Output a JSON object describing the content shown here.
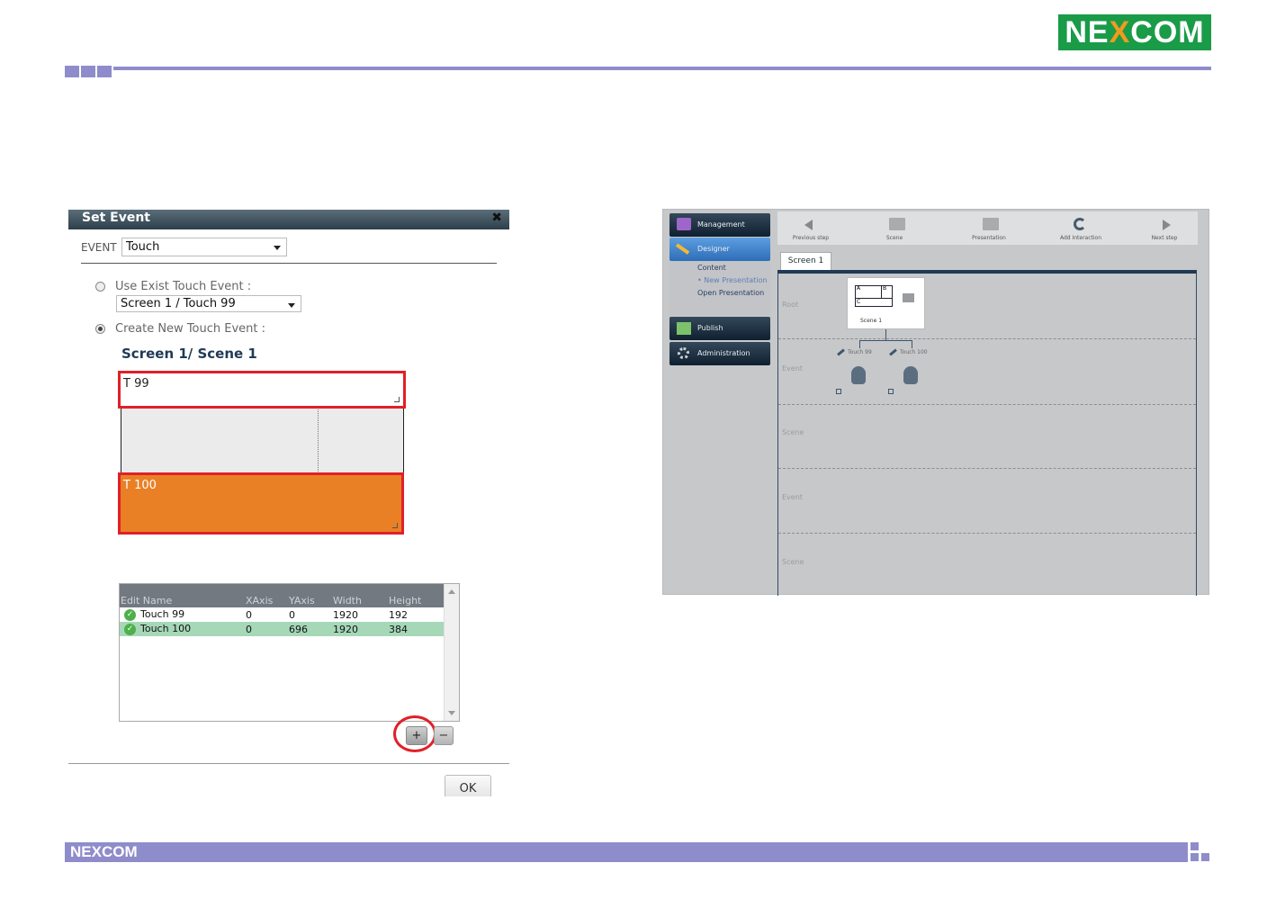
{
  "header": {
    "logo_pre": "NE",
    "logo_x": "X",
    "logo_post": "COM"
  },
  "footer": {
    "logo_pre": "NE",
    "logo_x": "X",
    "logo_post": "COM"
  },
  "dialog": {
    "title": "Set Event",
    "close_glyph": "✖",
    "event_label": "EVENT",
    "event_value": "Touch",
    "use_exist_label": "Use Exist Touch Event :",
    "use_exist_value": "Screen 1 / Touch 99",
    "create_new_label": "Create New Touch Event :",
    "scene_heading": "Screen 1/ Scene 1",
    "region_top_text": "T 99",
    "region_bottom_text": "T 100",
    "table": {
      "columns": [
        "Edit Name",
        "XAxis",
        "YAxis",
        "Width",
        "Height"
      ],
      "rows": [
        {
          "name": "Touch 99",
          "x": "0",
          "y": "0",
          "w": "1920",
          "h": "192"
        },
        {
          "name": "Touch 100",
          "x": "0",
          "y": "696",
          "w": "1920",
          "h": "384"
        }
      ]
    },
    "add_label": "+",
    "remove_label": "−",
    "ok_label": "OK"
  },
  "app": {
    "nav": [
      {
        "label": "Management"
      },
      {
        "label": "Designer"
      },
      {
        "label": "Publish"
      },
      {
        "label": "Administration"
      }
    ],
    "subnav": [
      "Content",
      "• New Presentation",
      "Open Presentation"
    ],
    "toolbar": [
      "Previous step",
      "Scene",
      "Presentation",
      "Add Interaction",
      "Next step"
    ],
    "tab": "Screen 1",
    "lanes": [
      "Root",
      "Event",
      "Scene",
      "Event",
      "Scene"
    ],
    "scene_node": {
      "a": "A",
      "b": "B",
      "c": "C",
      "label": "Scene 1"
    },
    "events": [
      "Touch 99",
      "Touch 100"
    ]
  },
  "colors": {
    "brand_green": "#1a9b48",
    "brand_orange": "#f39a1e",
    "accent_purple": "#8f8ccb",
    "highlight_red": "#e02028",
    "region_orange": "#e98025",
    "row_selected": "#a6d8b8"
  }
}
